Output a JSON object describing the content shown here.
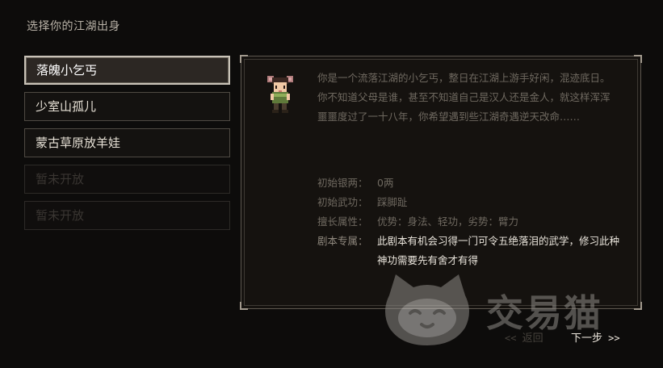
{
  "page": {
    "title": "选择你的江湖出身"
  },
  "origins": [
    {
      "label": "落魄小乞丐",
      "state": "selected"
    },
    {
      "label": "少室山孤儿",
      "state": "normal"
    },
    {
      "label": "蒙古草原放羊娃",
      "state": "normal"
    },
    {
      "label": "暂未开放",
      "state": "locked"
    },
    {
      "label": "暂未开放",
      "state": "locked"
    }
  ],
  "detail": {
    "portrait_icon": "beggar-girl-sprite",
    "description": "你是一个流落江湖的小乞丐，整日在江湖上游手好闲，混迹底日。你不知道父母是谁，甚至不知道自己是汉人还是金人，就这样浑浑噩噩度过了一十八年，你希望遇到些江湖奇遇逆天改命……",
    "stats": [
      {
        "label": "初始银两：",
        "value": "0两"
      },
      {
        "label": "初始武功：",
        "value": "踩脚趾"
      },
      {
        "label": "擅长属性：",
        "value": "优势：身法、轻功，劣势：臂力"
      },
      {
        "label": "剧本专属：",
        "value": "此剧本有机会习得一门可令五绝落泪的武学，修习此种神功需要先有舍才有得"
      }
    ]
  },
  "footer": {
    "back_label": "返回",
    "back_arrow": "<<",
    "next_label": "下一步",
    "next_arrow": ">>"
  },
  "watermark": {
    "text": "交易猫",
    "icon": "cat-logo-icon"
  },
  "colors": {
    "background": "#0d0c0b",
    "panel_border": "#5d574f",
    "selected_bg": "#2c2723",
    "text_primary": "#e7e1d6",
    "text_dim": "#6f6960"
  }
}
